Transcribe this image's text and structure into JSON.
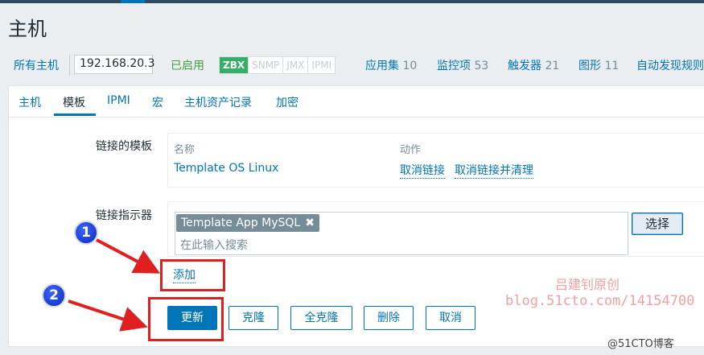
{
  "page": {
    "title": "主机"
  },
  "breadcrumb": {
    "all_hosts": "所有主机",
    "host": "192.168.20.3",
    "status": "已启用",
    "availability": [
      "ZBX",
      "SNMP",
      "JMX",
      "IPMI"
    ],
    "links": [
      {
        "label": "应用集",
        "count": "10"
      },
      {
        "label": "监控项",
        "count": "53"
      },
      {
        "label": "触发器",
        "count": "21"
      },
      {
        "label": "图形",
        "count": "11"
      },
      {
        "label": "自动发现规则"
      }
    ]
  },
  "tabs": [
    "主机",
    "模板",
    "IPMI",
    "宏",
    "主机资产记录",
    "加密"
  ],
  "active_tab": "模板",
  "linked_templates": {
    "label": "链接的模板",
    "col_name": "名称",
    "col_action": "动作",
    "rows": [
      {
        "name": "Template OS Linux",
        "unlink": "取消链接",
        "unlink_clear": "取消链接并清理"
      }
    ]
  },
  "link_indicator": {
    "label": "链接指示器",
    "selected": "Template App MySQL",
    "placeholder": "在此输入搜索",
    "select_button": "选择",
    "add": "添加"
  },
  "actions": {
    "update": "更新",
    "clone": "克隆",
    "full_clone": "全克隆",
    "delete": "删除",
    "cancel": "取消"
  },
  "annotations": {
    "marker1": "1",
    "marker2": "2"
  },
  "watermark": {
    "line1": "吕建钊原创",
    "line2": "blog.51cto.com/14154700",
    "line3": "@51CTO博客"
  },
  "colors": {
    "accent": "#0275b8",
    "enabled": "#429e47",
    "highlight": "#e02020"
  }
}
